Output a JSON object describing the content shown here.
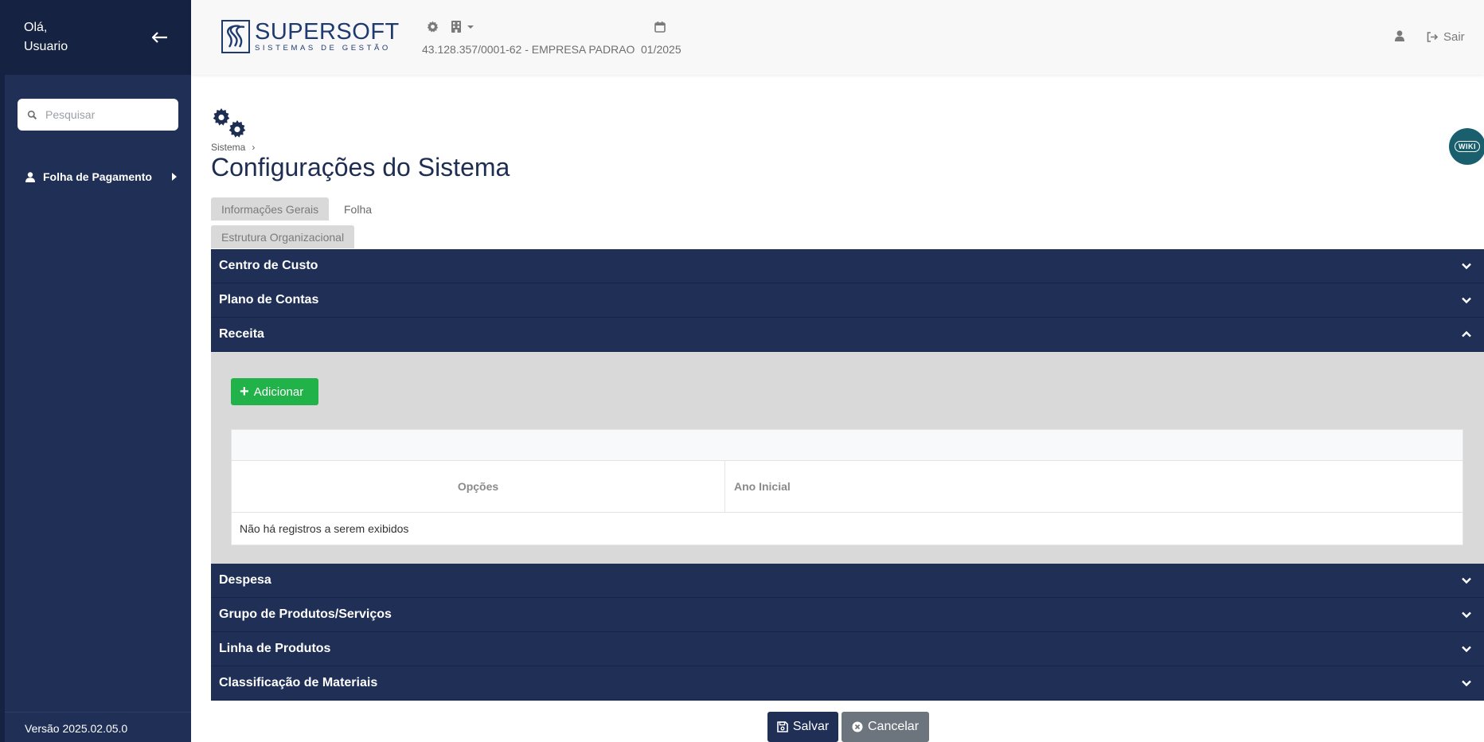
{
  "sidebar": {
    "greeting_line1": "Olá,",
    "greeting_line2": "Usuario",
    "back_icon": "arrow-left-icon",
    "search_placeholder": "Pesquisar",
    "items": [
      {
        "label": "Folha de Pagamento",
        "icon": "user-icon"
      }
    ],
    "version": "Versão 2025.02.05.0"
  },
  "header": {
    "logo_name": "SUPERSOFT",
    "logo_tagline": "SISTEMAS DE GESTÃO",
    "company": "43.128.357/0001-62 - EMPRESA PADRAO",
    "period": "01/2025",
    "logout_label": "Sair"
  },
  "page": {
    "breadcrumb_root": "Sistema",
    "title": "Configurações do Sistema",
    "wiki_label": "WIKI"
  },
  "tabs": [
    {
      "label": "Informações Gerais",
      "active": true
    },
    {
      "label": "Folha",
      "active": false
    },
    {
      "label": "Estrutura Organizacional",
      "active": true
    }
  ],
  "accordion": {
    "sections": [
      "Centro de Custo",
      "Plano de Contas",
      "Receita",
      "Despesa",
      "Grupo de Produtos/Serviços",
      "Linha de Produtos",
      "Classificação de Materiais"
    ],
    "expanded": "Receita"
  },
  "receita": {
    "add_label": "Adicionar",
    "columns": [
      "Opções",
      "Ano Inicial"
    ],
    "empty_message": "Não há registros a serem exibidos"
  },
  "actions": {
    "save_label": "Salvar",
    "cancel_label": "Cancelar"
  },
  "colors": {
    "primary": "#1f2f56",
    "sidebar_dark": "#152242",
    "success": "#21b24a",
    "secondary": "#6c757d"
  }
}
